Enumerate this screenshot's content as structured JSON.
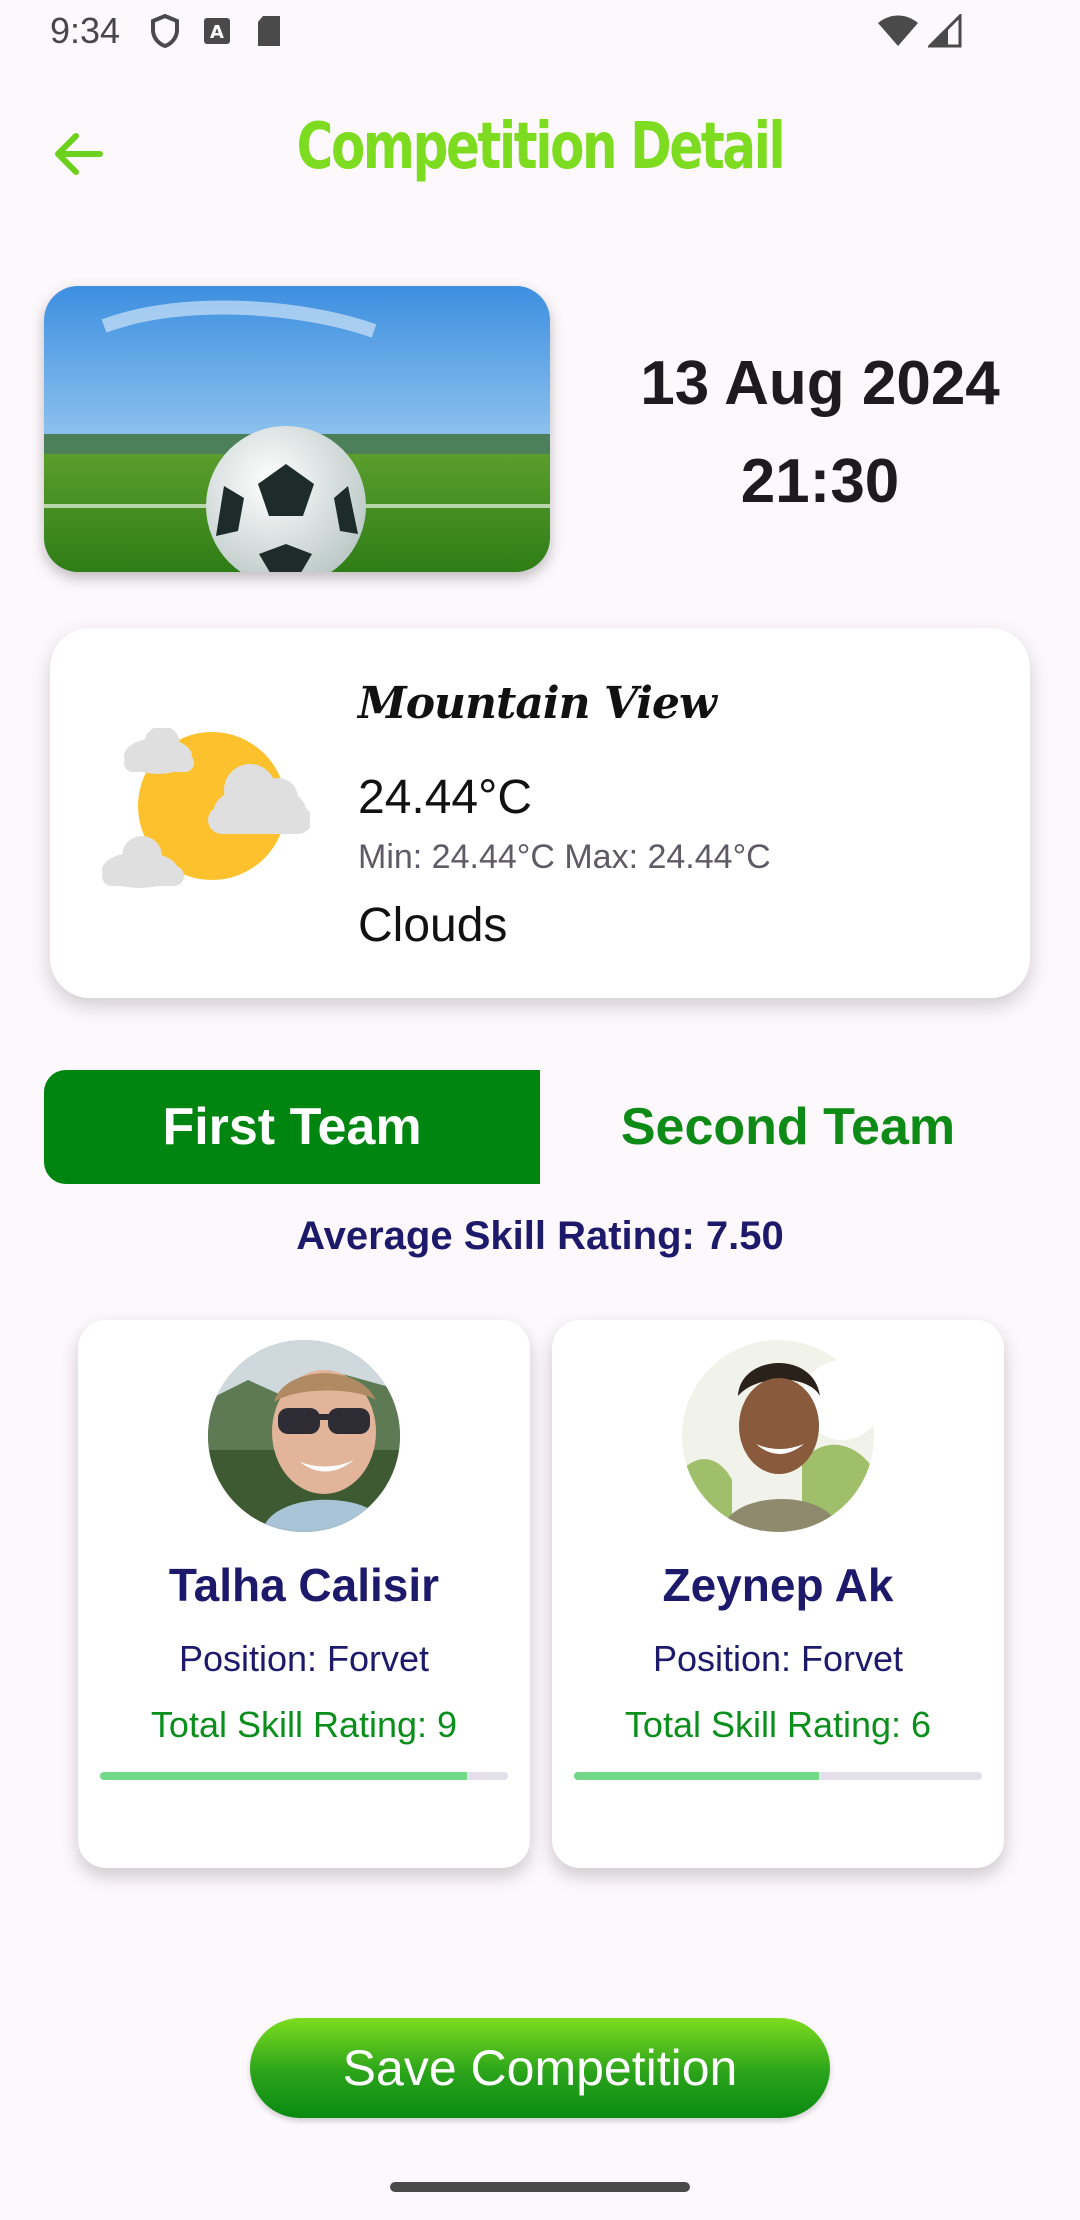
{
  "status_bar": {
    "time": "9:34",
    "icons_left": [
      "shield-icon",
      "font-icon",
      "sd-card-icon"
    ],
    "icons_right": [
      "wifi-icon",
      "cell-signal-icon"
    ]
  },
  "app_bar": {
    "title": "Competition Detail",
    "back_icon": "arrow-back-icon",
    "title_color": "#7ddc1f"
  },
  "competition": {
    "date": "13 Aug 2024",
    "time": "21:30",
    "image": "soccer-ball-on-grass"
  },
  "weather": {
    "city": "Mountain View",
    "temperature": "24.44°C",
    "min_max": "Min: 24.44°C Max: 24.44°C",
    "condition": "Clouds",
    "icon": "sun-behind-clouds-icon"
  },
  "tabs": {
    "first": "First Team",
    "second": "Second Team",
    "active": "first",
    "active_color": "#008610"
  },
  "team": {
    "average_rating": "Average Skill Rating: 7.50",
    "players": [
      {
        "name": "Talha Calisir",
        "position": "Position: Forvet",
        "skill": "Total Skill Rating: 9",
        "rating_fraction": 0.9
      },
      {
        "name": "Zeynep Ak",
        "position": "Position: Forvet",
        "skill": "Total Skill Rating: 6",
        "rating_fraction": 0.6
      }
    ]
  },
  "actions": {
    "save": "Save Competition"
  }
}
